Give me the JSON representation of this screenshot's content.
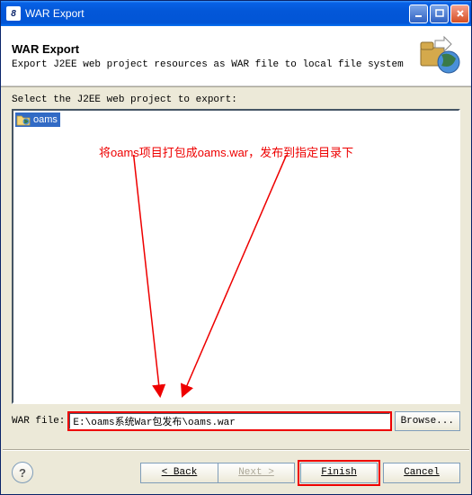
{
  "titlebar": {
    "title": "WAR Export"
  },
  "header": {
    "title": "WAR Export",
    "desc": "Export J2EE web project resources as WAR file to local file system"
  },
  "content": {
    "select_label": "Select the J2EE web project to export:",
    "project_name": "oams",
    "annotation": "将oams项目打包成oams.war，发布到指定目录下"
  },
  "path": {
    "label": "WAR file:",
    "value": "E:\\oams系统War包发布\\oams.war",
    "browse": "Browse..."
  },
  "footer": {
    "help": "?",
    "back": "< Back",
    "next": "Next >",
    "finish": "Finish",
    "cancel": "Cancel"
  }
}
